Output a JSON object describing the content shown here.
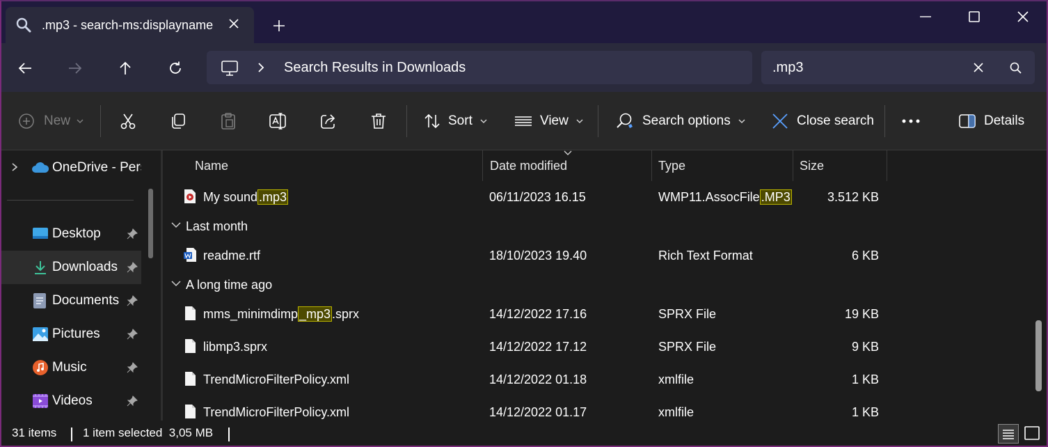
{
  "window": {
    "tab_title": ".mp3 - search-ms:displayname",
    "colors": {
      "titlebar": "#1f1a3d",
      "navbar": "#2a2a3c",
      "highlight_bg": "#4d4a00",
      "highlight_border": "#b9b300"
    }
  },
  "nav": {
    "address_icon": "this-pc-icon",
    "breadcrumb": "Search Results in Downloads",
    "search_value": ".mp3"
  },
  "toolbar": {
    "new_label": "New",
    "sort_label": "Sort",
    "view_label": "View",
    "search_options_label": "Search options",
    "close_search_label": "Close search",
    "details_label": "Details"
  },
  "sidebar": {
    "onedrive_label": "OneDrive - Perso",
    "items": [
      {
        "label": "Desktop",
        "icon": "desktop-icon"
      },
      {
        "label": "Downloads",
        "icon": "download-icon"
      },
      {
        "label": "Documents",
        "icon": "documents-icon"
      },
      {
        "label": "Pictures",
        "icon": "pictures-icon"
      },
      {
        "label": "Music",
        "icon": "music-icon"
      },
      {
        "label": "Videos",
        "icon": "videos-icon"
      }
    ]
  },
  "columns": {
    "name": "Name",
    "date": "Date modified",
    "type": "Type",
    "size": "Size"
  },
  "files": {
    "row0": {
      "name_pre": "My sound",
      "name_hl": ".mp3",
      "name_post": "",
      "date": "06/11/2023 16.15",
      "type_pre": "WMP11.AssocFile",
      "type_hl": ".MP3",
      "size": "3.512 KB"
    },
    "group1": "Last month",
    "row1": {
      "name": "readme.rtf",
      "date": "18/10/2023 19.40",
      "type": "Rich Text Format",
      "size": "6 KB"
    },
    "group2": "A long time ago",
    "row2": {
      "name_pre": "mms_minimdimp",
      "name_hl": "_mp3",
      "name_post": ".sprx",
      "date": "14/12/2022 17.16",
      "type": "SPRX File",
      "size": "19 KB"
    },
    "row3": {
      "name": "libmp3.sprx",
      "date": "14/12/2022 17.12",
      "type": "SPRX File",
      "size": "9 KB"
    },
    "row4": {
      "name": "TrendMicroFilterPolicy.xml",
      "date": "14/12/2022 01.18",
      "type": "xmlfile",
      "size": "1 KB"
    },
    "row5": {
      "name": "TrendMicroFilterPolicy.xml",
      "date": "14/12/2022 01.17",
      "type": "xmlfile",
      "size": "1 KB"
    }
  },
  "status": {
    "count": "31 items",
    "selection": "1 item selected  3,05 MB"
  }
}
